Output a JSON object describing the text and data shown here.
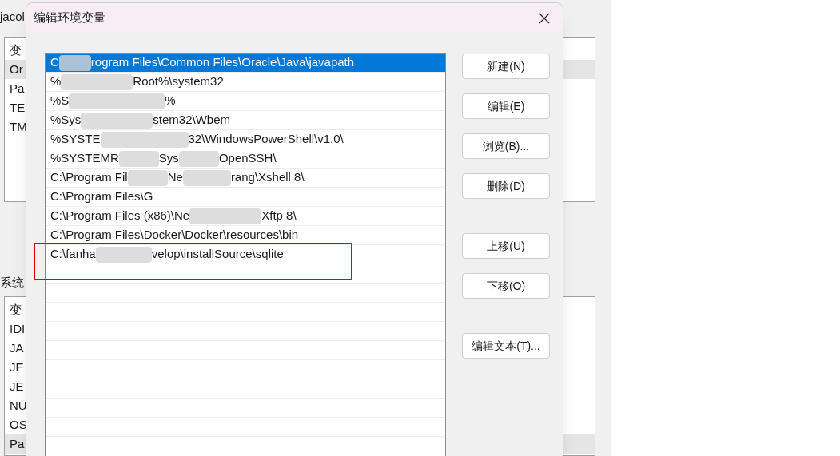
{
  "background_window": {
    "user_label": "jacol",
    "user_list": [
      {
        "text": "变"
      },
      {
        "text": "Or",
        "selected": true
      },
      {
        "text": "Pa",
        "selected": false
      },
      {
        "text": "TE",
        "selected": false
      },
      {
        "text": "TM",
        "selected": false
      }
    ],
    "system_label": "系统",
    "system_list": [
      {
        "text": "变"
      },
      {
        "text": "IDI",
        "selected": false
      },
      {
        "text": "JA",
        "selected": false
      },
      {
        "text": "JE",
        "selected": false
      },
      {
        "text": "JE",
        "selected": false
      },
      {
        "text": "NU",
        "selected": false
      },
      {
        "text": "OS",
        "selected": false
      },
      {
        "text": "Pa",
        "selected": true
      }
    ]
  },
  "dialog": {
    "title": "编辑环境变量",
    "paths": [
      {
        "parts": [
          "C",
          "rogram Files\\Common Files\\Oracle\\Java\\javapath"
        ],
        "selected": true
      },
      {
        "parts": [
          "%",
          "Root%\\system32"
        ],
        "selected": false
      },
      {
        "parts": [
          "%S",
          "%"
        ],
        "selected": false
      },
      {
        "parts": [
          "%Sys",
          "stem32\\Wbem"
        ],
        "selected": false
      },
      {
        "parts": [
          "%SYSTE",
          "32\\WindowsPowerShell\\v1.0\\"
        ],
        "selected": false
      },
      {
        "parts": [
          "%SYSTEMR",
          "Sys",
          "OpenSSH\\"
        ],
        "selected": false
      },
      {
        "parts": [
          "C:\\Program Fil",
          "Ne",
          "rang\\Xshell 8\\"
        ],
        "selected": false
      },
      {
        "parts": [
          "C:\\Program Files\\G"
        ],
        "selected": false
      },
      {
        "parts": [
          "C:\\Program Files (x86)\\Ne",
          "Xftp 8\\"
        ],
        "selected": false
      },
      {
        "parts": [
          "C:\\Program Files\\Docker\\Docker\\resources\\bin"
        ],
        "selected": false
      },
      {
        "parts": [
          "C:\\fanha",
          "velop\\installSource\\sqlite"
        ],
        "selected": false
      }
    ],
    "buttons": [
      {
        "label": "新建(N)"
      },
      {
        "label": "编辑(E)"
      },
      {
        "label": "浏览(B)..."
      },
      {
        "label": "删除(D)"
      },
      {
        "label": "上移(U)"
      },
      {
        "label": "下移(O)"
      },
      {
        "label": "编辑文本(T)..."
      }
    ]
  }
}
